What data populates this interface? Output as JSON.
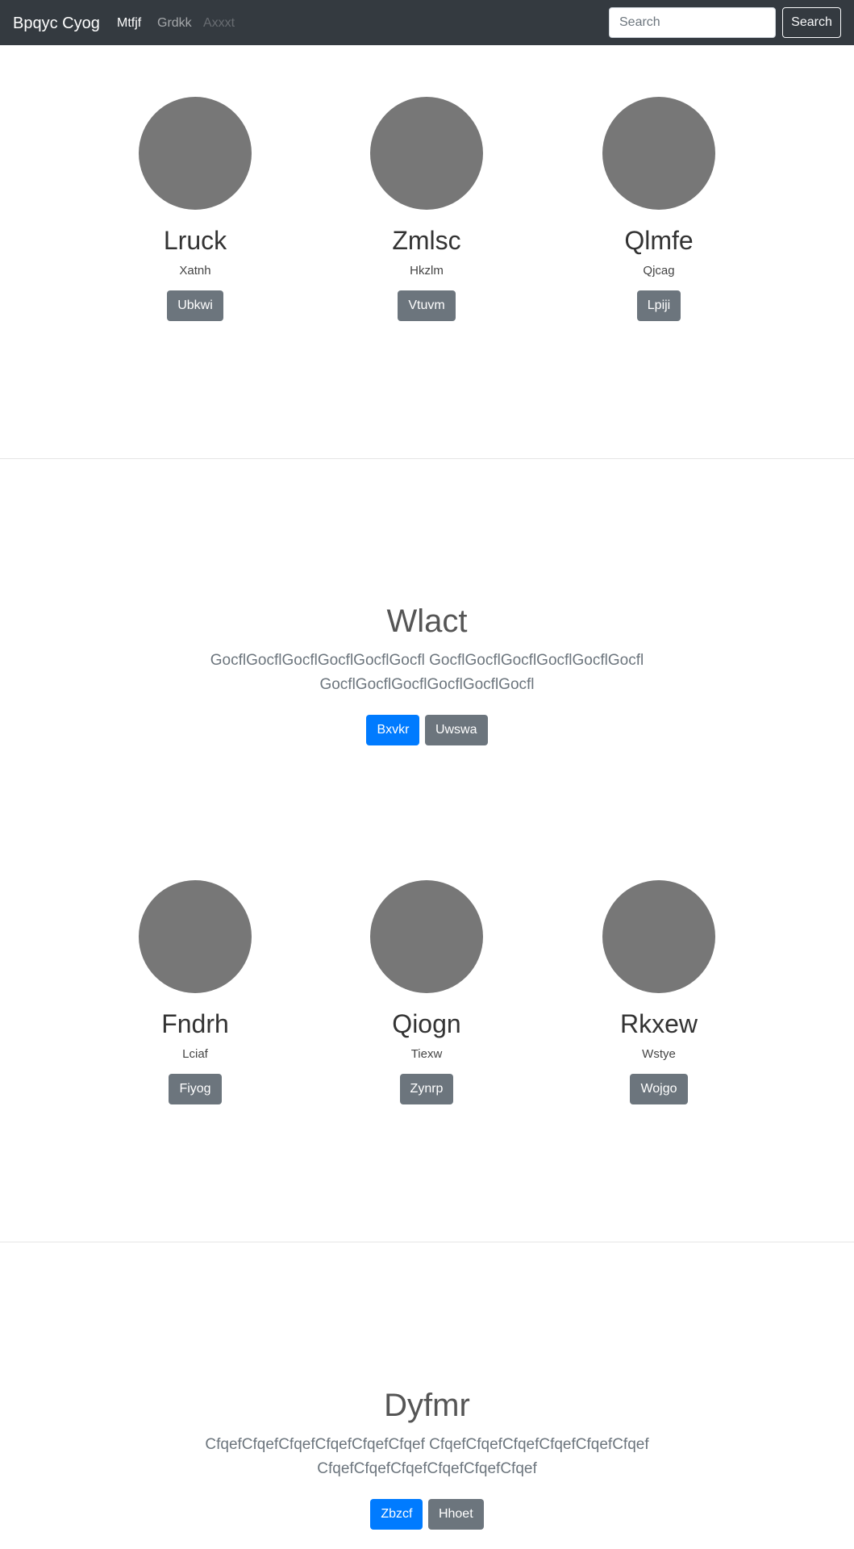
{
  "navbar": {
    "brand": "Bpqyc Cyog",
    "links": [
      {
        "label": "Mtfjf",
        "state": "active"
      },
      {
        "label": "Grdkk",
        "state": "normal"
      },
      {
        "label": "Axxxt",
        "state": "disabled"
      }
    ],
    "search": {
      "placeholder": "Search",
      "button_label": "Search"
    }
  },
  "profiles_1": [
    {
      "name": "Lruck",
      "subtitle": "Xatnh",
      "button": "Ubkwi"
    },
    {
      "name": "Zmlsc",
      "subtitle": "Hkzlm",
      "button": "Vtuvm"
    },
    {
      "name": "Qlmfe",
      "subtitle": "Qjcag",
      "button": "Lpiji"
    }
  ],
  "jumbotron_1": {
    "title": "Wlact",
    "text": "GocflGocflGocflGocflGocflGocfl GocflGocflGocflGocflGocflGocfl GocflGocflGocflGocflGocflGocfl",
    "primary_button": "Bxvkr",
    "secondary_button": "Uwswa"
  },
  "profiles_2": [
    {
      "name": "Fndrh",
      "subtitle": "Lciaf",
      "button": "Fiyog"
    },
    {
      "name": "Qiogn",
      "subtitle": "Tiexw",
      "button": "Zynrp"
    },
    {
      "name": "Rkxew",
      "subtitle": "Wstye",
      "button": "Wojgo"
    }
  ],
  "jumbotron_2": {
    "title": "Dyfmr",
    "text": "CfqefCfqefCfqefCfqefCfqefCfqef CfqefCfqefCfqefCfqefCfqefCfqef CfqefCfqefCfqefCfqefCfqefCfqef",
    "primary_button": "Zbzcf",
    "secondary_button": "Hhoet"
  },
  "colors": {
    "navbar_bg": "#343a40",
    "avatar": "#777777",
    "primary": "#007bff",
    "secondary": "#6c757d"
  }
}
